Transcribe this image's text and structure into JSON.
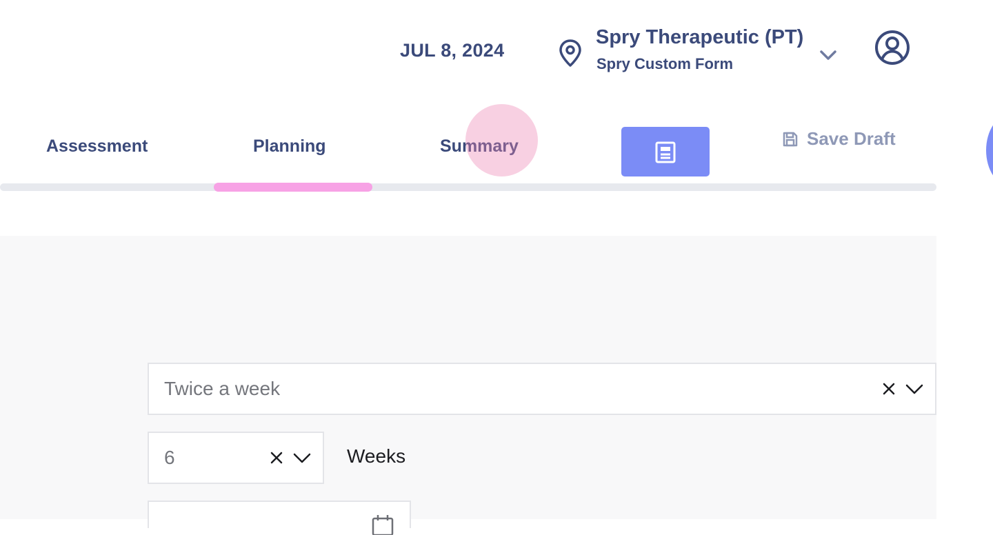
{
  "header": {
    "date": "JUL 8, 2024",
    "location_icon": "map-pin-icon",
    "clinic_name": "Spry Therapeutic (PT)",
    "clinic_form": "Spry Custom Form",
    "dropdown_icon": "chevron-down-icon",
    "profile_icon": "user-circle-icon"
  },
  "tabs": {
    "assessment": "Assessment",
    "planning": "Planning",
    "summary": "Summary",
    "active": "Planning"
  },
  "toolbar": {
    "note_icon": "document-icon",
    "save_draft_label": "Save Draft",
    "save_icon": "floppy-disk-icon"
  },
  "form": {
    "frequency": {
      "value": "Twice a week",
      "clear_icon": "close-icon",
      "dropdown_icon": "chevron-down-icon"
    },
    "duration": {
      "value": "6",
      "unit_label": "Weeks",
      "clear_icon": "close-icon",
      "dropdown_icon": "chevron-down-icon"
    },
    "date_field": {
      "icon": "calendar-icon"
    }
  },
  "colors": {
    "primary_text": "#3b4a7a",
    "accent_button": "#7b8cf6",
    "tab_indicator": "#f7a2e5",
    "muted_text": "#8e98b6",
    "panel_background": "#f8f8f9"
  }
}
